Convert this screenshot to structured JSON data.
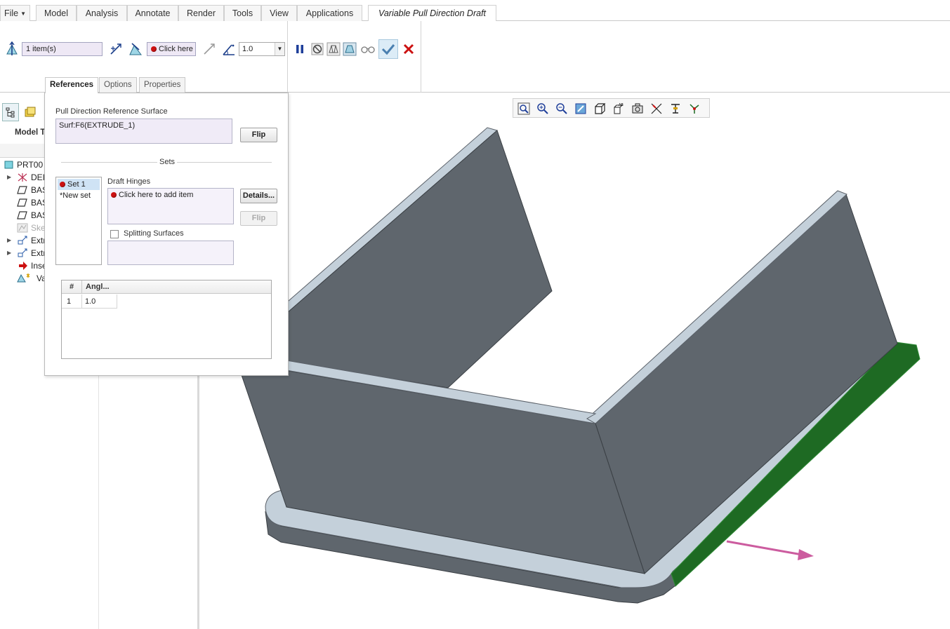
{
  "menu": {
    "file": "File",
    "tabs": [
      "Model",
      "Analysis",
      "Annotate",
      "Render",
      "Tools",
      "View",
      "Applications"
    ],
    "active_tab": "Variable Pull Direction Draft"
  },
  "dashboard": {
    "pull_surface_collector": "1 item(s)",
    "hinge_collector": "Click here t",
    "angle_value": "1.0"
  },
  "subtabs": {
    "references": "References",
    "options": "Options",
    "properties": "Properties"
  },
  "references": {
    "pull_label": "Pull Direction Reference Surface",
    "pull_value": "Surf:F6(EXTRUDE_1)",
    "flip_label": "Flip",
    "sets_label": "Sets",
    "sets": [
      "Set 1",
      "*New set"
    ],
    "hinges_label": "Draft Hinges",
    "hinges_placeholder": "Click here to add item",
    "details_label": "Details...",
    "flip2_label": "Flip",
    "splitting_label": "Splitting Surfaces",
    "table": {
      "headers": [
        "#",
        "Angl..."
      ],
      "rows": [
        {
          "num": "1",
          "angle": "1.0"
        }
      ]
    }
  },
  "model_tree": {
    "header": "Model T",
    "items": [
      {
        "label": "PRT00"
      },
      {
        "label": "DEI"
      },
      {
        "label": "BAS"
      },
      {
        "label": "BAS"
      },
      {
        "label": "BAS"
      },
      {
        "label": "Ske"
      },
      {
        "label": "Extr"
      },
      {
        "label": "Extr"
      },
      {
        "label": "Inse"
      },
      {
        "label": "Va"
      }
    ]
  },
  "colors": {
    "part_body": "#5f666d",
    "part_edge_face": "#c4d0da",
    "selected_surface": "#1e6a23",
    "pull_arrow": "#cc5c9f",
    "required_dot": "#cc1111"
  }
}
